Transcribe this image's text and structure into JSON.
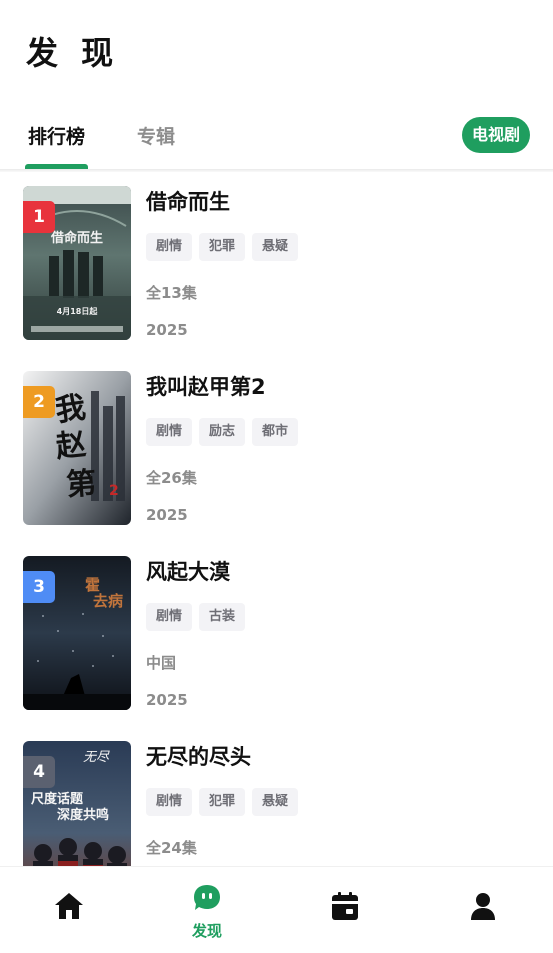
{
  "header": {
    "title": "发 现"
  },
  "tabs": [
    {
      "label": "排行榜",
      "active": true
    },
    {
      "label": "专辑",
      "active": false
    }
  ],
  "category_chip": {
    "label": "电视剧",
    "color": "#1f9e5f"
  },
  "list": [
    {
      "rank": "1",
      "rank_color": "#e8333c",
      "title": "借命而生",
      "tags": [
        "剧情",
        "犯罪",
        "悬疑"
      ],
      "meta1": "全13集",
      "meta2": "2025",
      "poster_text": "借命而生",
      "poster_date": "4月18日起"
    },
    {
      "rank": "2",
      "rank_color": "#ee9b22",
      "title": "我叫赵甲第2",
      "tags": [
        "剧情",
        "励志",
        "都市"
      ],
      "meta1": "全26集",
      "meta2": "2025",
      "poster_text": "我叫赵甲第"
    },
    {
      "rank": "3",
      "rank_color": "#4f8cf5",
      "title": "风起大漠",
      "tags": [
        "剧情",
        "古装"
      ],
      "meta1": "中国",
      "meta2": "2025",
      "poster_text": "霍去病"
    },
    {
      "rank": "4",
      "rank_color": "#5b6170",
      "title": "无尽的尽头",
      "tags": [
        "剧情",
        "犯罪",
        "悬疑"
      ],
      "meta1": "全24集",
      "meta2": "",
      "poster_text": "尺度话题 深度共鸣"
    }
  ],
  "bottom_nav": {
    "items": [
      {
        "icon": "home-icon",
        "label": ""
      },
      {
        "icon": "discover-icon",
        "label": "发现",
        "active": true
      },
      {
        "icon": "calendar-icon",
        "label": ""
      },
      {
        "icon": "profile-icon",
        "label": ""
      }
    ],
    "active_color": "#1f9e5f"
  }
}
